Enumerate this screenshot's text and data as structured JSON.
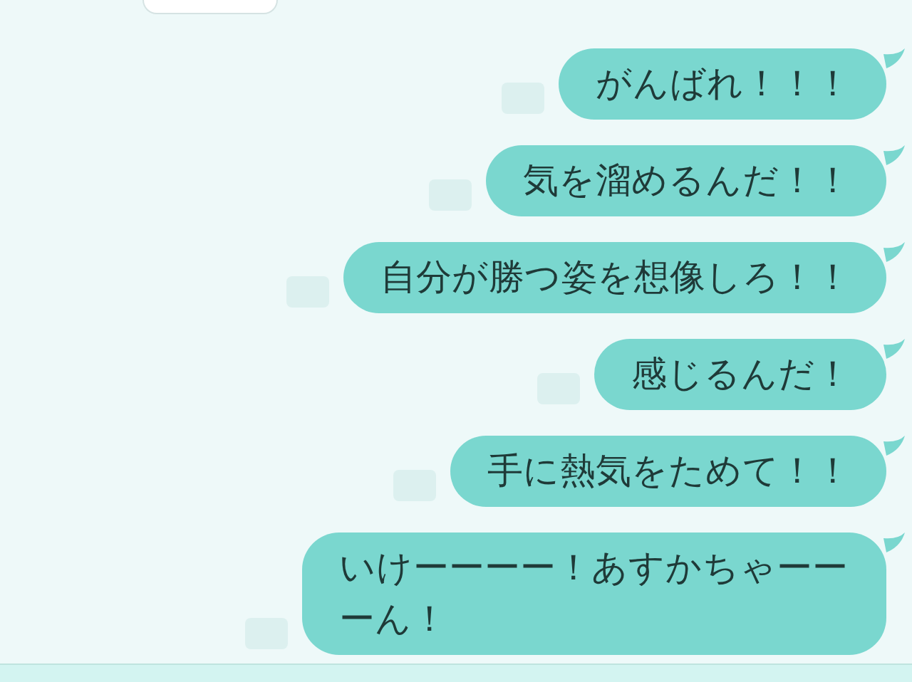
{
  "messages": [
    {
      "text": "がんばれ！！！"
    },
    {
      "text": "気を溜めるんだ！！"
    },
    {
      "text": "自分が勝つ姿を想像しろ！！"
    },
    {
      "text": "感じるんだ！"
    },
    {
      "text": "手に熱気をためて！！"
    },
    {
      "text": "いけーーーー！あすかちゃーーーん！"
    }
  ]
}
